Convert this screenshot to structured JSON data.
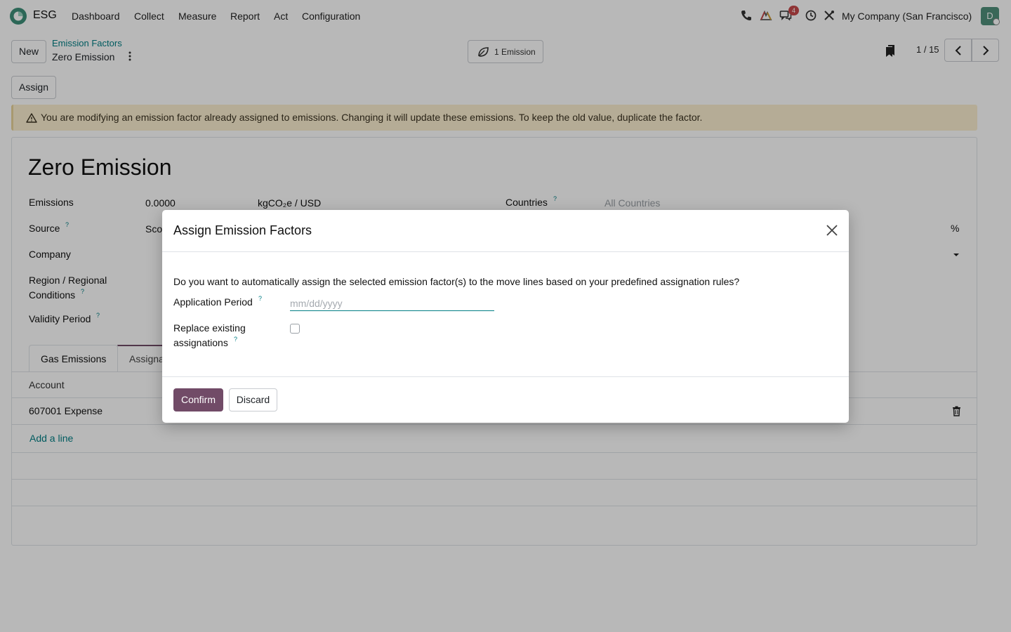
{
  "navbar": {
    "app_name": "ESG",
    "menu": [
      "Dashboard",
      "Collect",
      "Measure",
      "Report",
      "Act",
      "Configuration"
    ],
    "messages_badge": "4",
    "company": "My Company (San Francisco)",
    "avatar_initial": "D",
    "icons": [
      "phone-icon",
      "activity-chart-icon",
      "messages-icon",
      "clock-icon",
      "tools-icon"
    ]
  },
  "control_panel": {
    "new_label": "New",
    "breadcrumb_parent": "Emission Factors",
    "breadcrumb_current": "Zero Emission",
    "smart_button_label": "1 Emission",
    "pager": "1 / 15"
  },
  "actions": {
    "assign_label": "Assign"
  },
  "alert": {
    "text": "You are modifying an emission factor already assigned to emissions. Changing it will update these emissions. To keep the old value, duplicate the factor."
  },
  "form": {
    "title": "Zero Emission",
    "fields": {
      "emissions_label": "Emissions",
      "emissions_value": "0.0000",
      "emissions_unit": "kgCO₂e / USD",
      "countries_label": "Countries",
      "countries_placeholder": "All Countries",
      "source_label": "Source",
      "source_value_partial": "Sco",
      "percent_symbol": "%",
      "company_label": "Company",
      "region_label_line1": "Region / Regional",
      "region_label_line2": "Conditions",
      "validity_label": "Validity Period"
    },
    "help_mark": "?",
    "tabs": [
      "Gas Emissions",
      "Assigna"
    ],
    "list": {
      "column_header": "Account",
      "rows": [
        "607001 Expense"
      ],
      "add_line": "Add a line"
    }
  },
  "modal": {
    "title": "Assign Emission Factors",
    "question": "Do you want to automatically assign the selected emission factor(s) to the move lines based on your predefined assignation rules?",
    "application_period_label": "Application Period",
    "application_period_placeholder": "mm/dd/yyyy",
    "application_period_value": "",
    "replace_label_line1": "Replace existing",
    "replace_label_line2": "assignations",
    "replace_checked": false,
    "confirm_label": "Confirm",
    "discard_label": "Discard"
  },
  "colors": {
    "primary": "#714b67",
    "link": "#017e84",
    "alert_bg": "#fbefd0",
    "badge": "#c6484a",
    "avatar": "#4f8f7a"
  }
}
